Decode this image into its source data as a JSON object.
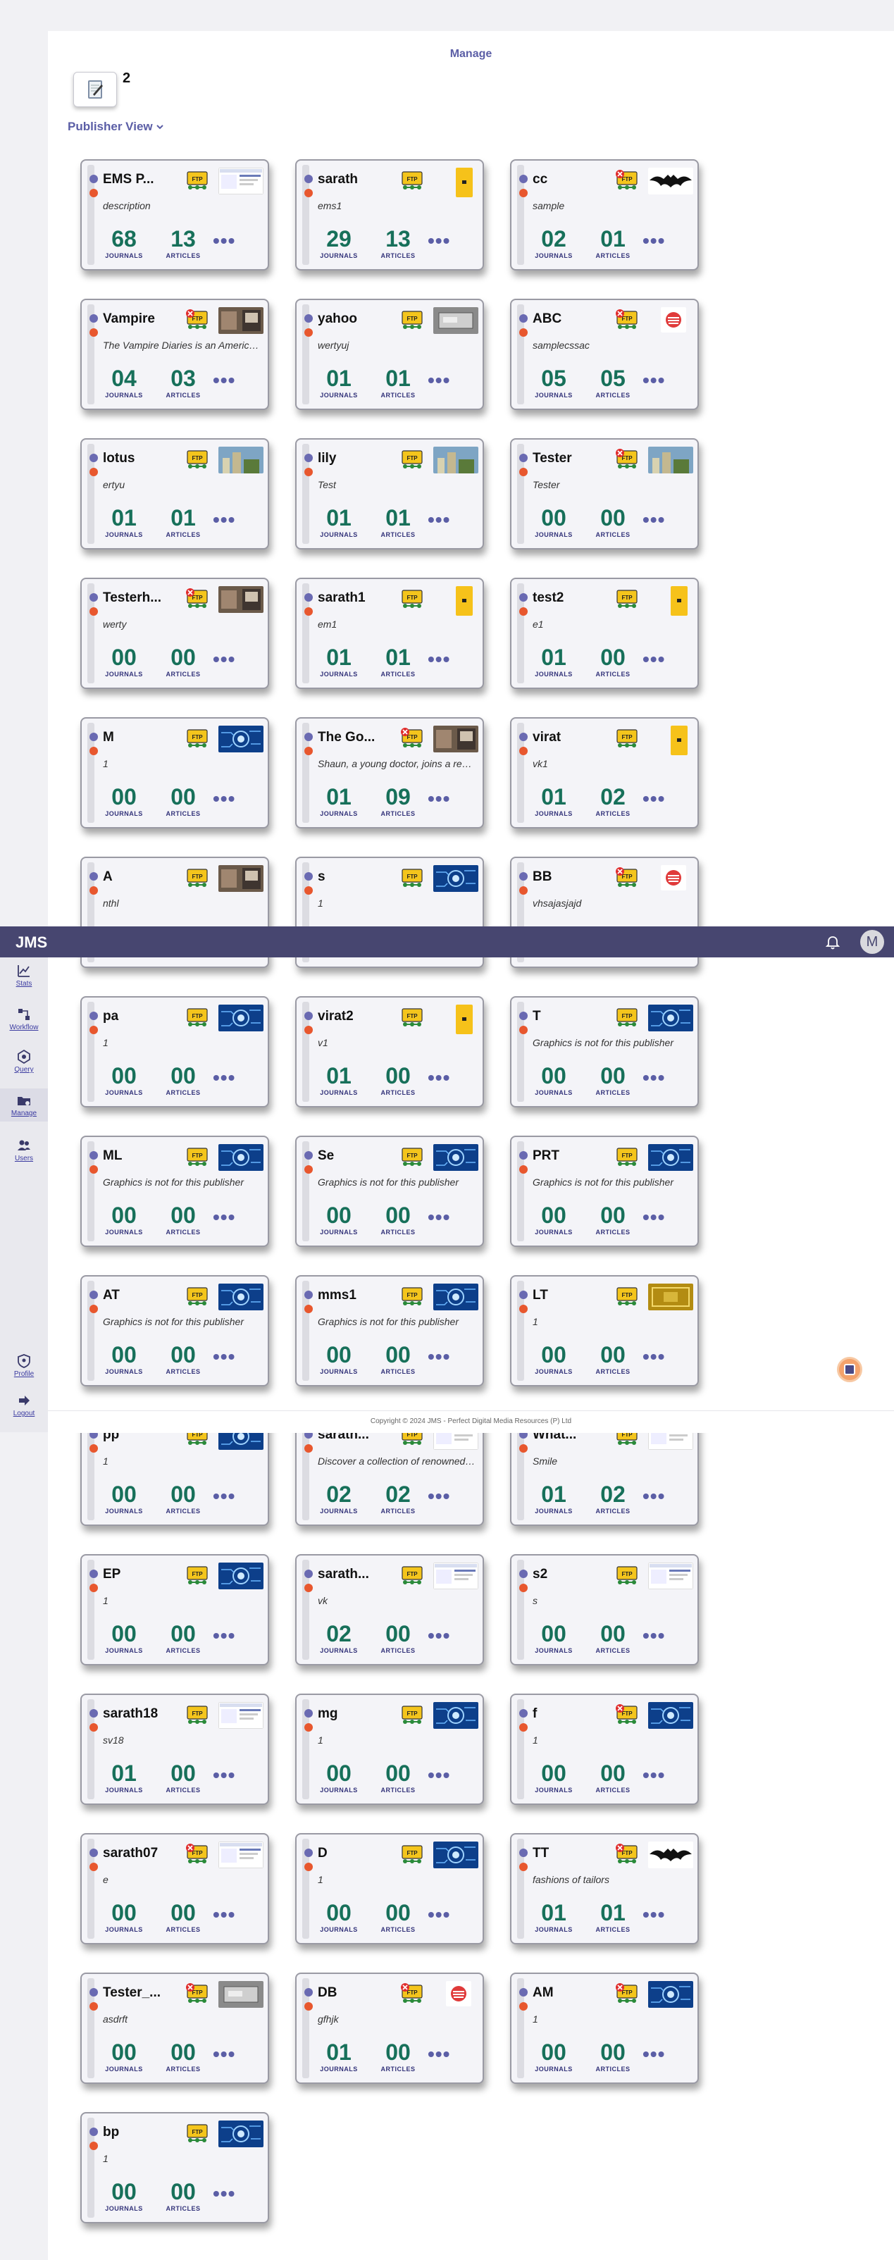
{
  "header": {
    "app_name": "JMS",
    "avatar_initial": "M",
    "bell_icon": "bell-icon"
  },
  "sidebar": {
    "items": [
      {
        "label": "Stats",
        "icon": "chart-icon"
      },
      {
        "label": "Workflow",
        "icon": "workflow-icon"
      },
      {
        "label": "Query",
        "icon": "query-icon"
      },
      {
        "label": "Manage",
        "icon": "folder-icon",
        "active": true
      },
      {
        "label": "Users",
        "icon": "users-icon"
      },
      {
        "label": "Profile",
        "icon": "profile-icon"
      },
      {
        "label": "Logout",
        "icon": "logout-icon"
      }
    ]
  },
  "main": {
    "title": "Manage",
    "count": "2",
    "view_dropdown": "Publisher View",
    "journals_label": "JOURNALS",
    "articles_label": "ARTICLES",
    "more_label": "•••"
  },
  "publishers": [
    {
      "name": "EMS P...",
      "desc": "description",
      "journals": "68",
      "articles": "13",
      "ftp_error": false,
      "thumb": "screenshot"
    },
    {
      "name": "sarath",
      "desc": "ems1",
      "journals": "29",
      "articles": "13",
      "ftp_error": false,
      "thumb": "yellow"
    },
    {
      "name": "cc",
      "desc": "sample",
      "journals": "02",
      "articles": "01",
      "ftp_error": true,
      "thumb": "batman"
    },
    {
      "name": "Vampire",
      "desc": "The Vampire Diaries is an American...",
      "journals": "04",
      "articles": "03",
      "ftp_error": true,
      "thumb": "room"
    },
    {
      "name": "yahoo",
      "desc": "wertyuj",
      "journals": "01",
      "articles": "01",
      "ftp_error": false,
      "thumb": "device"
    },
    {
      "name": "ABC",
      "desc": "samplecssac",
      "journals": "05",
      "articles": "05",
      "ftp_error": true,
      "thumb": "redlogo"
    },
    {
      "name": "lotus",
      "desc": "ertyu",
      "journals": "01",
      "articles": "01",
      "ftp_error": false,
      "thumb": "city"
    },
    {
      "name": "lily",
      "desc": "Test",
      "journals": "01",
      "articles": "01",
      "ftp_error": false,
      "thumb": "city"
    },
    {
      "name": "Tester",
      "desc": "Tester",
      "journals": "00",
      "articles": "00",
      "ftp_error": true,
      "thumb": "city"
    },
    {
      "name": "Testerh...",
      "desc": "werty",
      "journals": "00",
      "articles": "00",
      "ftp_error": true,
      "thumb": "room"
    },
    {
      "name": "sarath1",
      "desc": "em1",
      "journals": "01",
      "articles": "01",
      "ftp_error": false,
      "thumb": "yellow"
    },
    {
      "name": "test2",
      "desc": "e1",
      "journals": "01",
      "articles": "00",
      "ftp_error": false,
      "thumb": "yellow"
    },
    {
      "name": "M",
      "desc": "1",
      "journals": "00",
      "articles": "00",
      "ftp_error": false,
      "thumb": "tech"
    },
    {
      "name": "The Go...",
      "desc": "Shaun, a young doctor, joins a reno...",
      "journals": "01",
      "articles": "09",
      "ftp_error": true,
      "thumb": "room"
    },
    {
      "name": "virat",
      "desc": "vk1",
      "journals": "01",
      "articles": "02",
      "ftp_error": false,
      "thumb": "yellow"
    },
    {
      "name": "A",
      "desc": "nthl",
      "journals": "",
      "articles": "",
      "ftp_error": false,
      "thumb": "room"
    },
    {
      "name": "s",
      "desc": "1",
      "journals": "",
      "articles": "",
      "ftp_error": false,
      "thumb": "tech"
    },
    {
      "name": "BB",
      "desc": "vhsajasjajd",
      "journals": "",
      "articles": "",
      "ftp_error": true,
      "thumb": "redlogo"
    },
    {
      "name": "pa",
      "desc": "1",
      "journals": "00",
      "articles": "00",
      "ftp_error": false,
      "thumb": "tech"
    },
    {
      "name": "virat2",
      "desc": "v1",
      "journals": "01",
      "articles": "00",
      "ftp_error": false,
      "thumb": "yellow"
    },
    {
      "name": "T",
      "desc": "Graphics is not for this publisher",
      "journals": "00",
      "articles": "00",
      "ftp_error": false,
      "thumb": "tech"
    },
    {
      "name": "ML",
      "desc": "Graphics is not for this publisher",
      "journals": "00",
      "articles": "00",
      "ftp_error": false,
      "thumb": "tech"
    },
    {
      "name": "Se",
      "desc": "Graphics is not for this publisher",
      "journals": "00",
      "articles": "00",
      "ftp_error": false,
      "thumb": "tech"
    },
    {
      "name": "PRT",
      "desc": "Graphics is not for this publisher",
      "journals": "00",
      "articles": "00",
      "ftp_error": false,
      "thumb": "tech"
    },
    {
      "name": "AT",
      "desc": "Graphics is not for this publisher",
      "journals": "00",
      "articles": "00",
      "ftp_error": false,
      "thumb": "tech"
    },
    {
      "name": "mms1",
      "desc": "Graphics is not for this publisher",
      "journals": "00",
      "articles": "00",
      "ftp_error": false,
      "thumb": "tech"
    },
    {
      "name": "LT",
      "desc": "1",
      "journals": "00",
      "articles": "00",
      "ftp_error": false,
      "thumb": "gold"
    },
    {
      "name": "pp",
      "desc": "1",
      "journals": "00",
      "articles": "00",
      "ftp_error": false,
      "thumb": "tech"
    },
    {
      "name": "sarath...",
      "desc": "Discover a collection of renowned br...",
      "journals": "02",
      "articles": "02",
      "ftp_error": false,
      "thumb": "screenshot"
    },
    {
      "name": "What...",
      "desc": "Smile",
      "journals": "01",
      "articles": "02",
      "ftp_error": false,
      "thumb": "screenshot"
    },
    {
      "name": "EP",
      "desc": "1",
      "journals": "00",
      "articles": "00",
      "ftp_error": false,
      "thumb": "tech"
    },
    {
      "name": "sarath...",
      "desc": "vk",
      "journals": "02",
      "articles": "00",
      "ftp_error": false,
      "thumb": "screenshot"
    },
    {
      "name": "s2",
      "desc": "s",
      "journals": "00",
      "articles": "00",
      "ftp_error": false,
      "thumb": "screenshot"
    },
    {
      "name": "sarath18",
      "desc": "sv18",
      "journals": "01",
      "articles": "00",
      "ftp_error": false,
      "thumb": "screenshot"
    },
    {
      "name": "mg",
      "desc": "1",
      "journals": "00",
      "articles": "00",
      "ftp_error": false,
      "thumb": "tech"
    },
    {
      "name": "f",
      "desc": "1",
      "journals": "00",
      "articles": "00",
      "ftp_error": true,
      "thumb": "tech"
    },
    {
      "name": "sarath07",
      "desc": "e",
      "journals": "00",
      "articles": "00",
      "ftp_error": true,
      "thumb": "screenshot"
    },
    {
      "name": "D",
      "desc": "1",
      "journals": "00",
      "articles": "00",
      "ftp_error": false,
      "thumb": "tech"
    },
    {
      "name": "TT",
      "desc": "fashions of tailors",
      "journals": "01",
      "articles": "01",
      "ftp_error": true,
      "thumb": "batman"
    },
    {
      "name": "Tester_...",
      "desc": "asdrft",
      "journals": "00",
      "articles": "00",
      "ftp_error": true,
      "thumb": "device"
    },
    {
      "name": "DB",
      "desc": "gfhjk",
      "journals": "01",
      "articles": "00",
      "ftp_error": true,
      "thumb": "redlogo"
    },
    {
      "name": "AM",
      "desc": "1",
      "journals": "00",
      "articles": "00",
      "ftp_error": true,
      "thumb": "tech"
    },
    {
      "name": "bp",
      "desc": "1",
      "journals": "00",
      "articles": "00",
      "ftp_error": false,
      "thumb": "tech"
    }
  ],
  "footer": {
    "copyright": "Copyright © 2024 JMS - Perfect Digital Media Resources (P) Ltd"
  },
  "colors": {
    "accent": "#5b5ea6",
    "topbar": "#474670",
    "stat_number": "#17705a",
    "status_red": "#e8572e",
    "status_blue": "#6a6ab2"
  }
}
